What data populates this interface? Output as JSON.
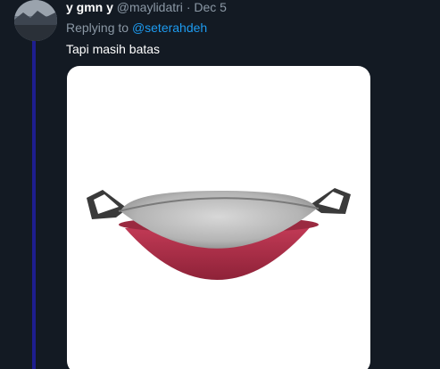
{
  "tweet": {
    "display_name": "y gmn y",
    "handle": "@maylidatri",
    "separator": "·",
    "date": "Dec 5",
    "replying_prefix": "Replying to",
    "replying_to": "@seterahdeh",
    "text": "Tapi masih batas"
  },
  "media": {
    "description_icon": "wok-pan-image"
  },
  "colors": {
    "background": "#131a23",
    "thread_line": "#1e1e8f",
    "mention": "#1d9bf0",
    "muted": "#8b98a5",
    "wok_body": "#b5314c"
  }
}
